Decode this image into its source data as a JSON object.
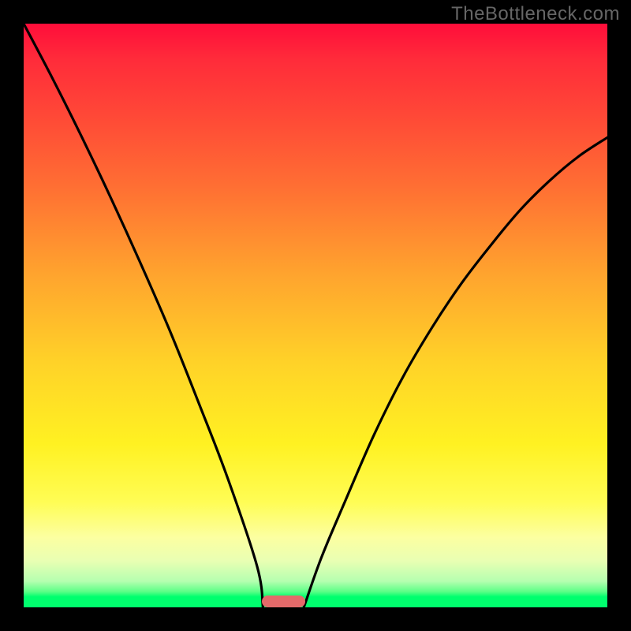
{
  "watermark": "TheBottleneck.com",
  "chart_data": {
    "type": "line",
    "title": "",
    "xlabel": "",
    "ylabel": "",
    "xlim": [
      0,
      1
    ],
    "ylim": [
      0,
      1
    ],
    "background_gradient": {
      "top": "#ff0d3a",
      "bottom": "#00ff6e",
      "note": "vertical red→orange→yellow→green gradient; y≈0 green (low bottleneck), y≈1 red (high bottleneck)"
    },
    "optimal_marker": {
      "x_center": 0.445,
      "x_width": 0.075,
      "y": 0.0,
      "color": "#e46a6a"
    },
    "series": [
      {
        "name": "left-curve",
        "x": [
          0.0,
          0.05,
          0.1,
          0.15,
          0.2,
          0.25,
          0.3,
          0.35,
          0.4,
          0.41
        ],
        "y": [
          1.0,
          0.905,
          0.805,
          0.7,
          0.59,
          0.475,
          0.35,
          0.22,
          0.07,
          0.0
        ]
      },
      {
        "name": "right-curve",
        "x": [
          0.48,
          0.51,
          0.55,
          0.6,
          0.65,
          0.7,
          0.75,
          0.8,
          0.85,
          0.9,
          0.95,
          1.0
        ],
        "y": [
          0.0,
          0.085,
          0.18,
          0.295,
          0.395,
          0.48,
          0.555,
          0.62,
          0.68,
          0.73,
          0.772,
          0.805
        ]
      }
    ]
  }
}
